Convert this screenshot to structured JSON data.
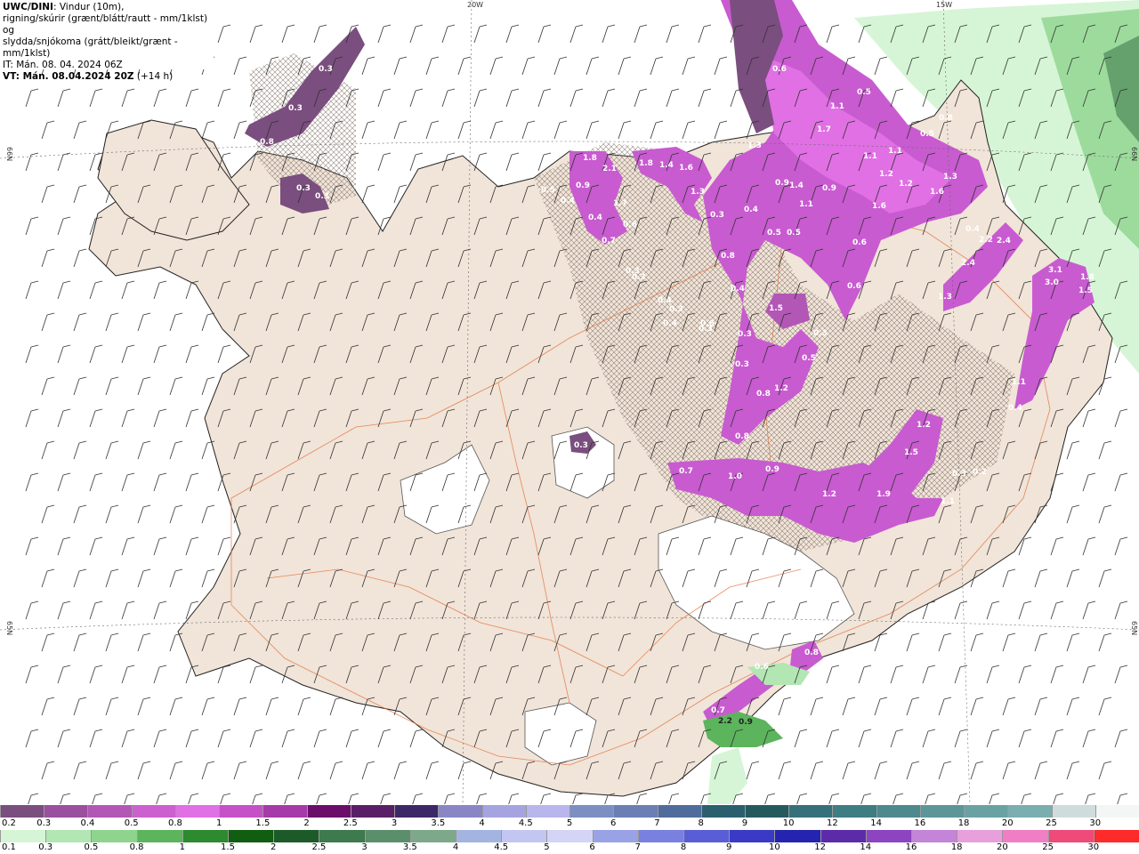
{
  "header": {
    "model": "UWC/DINI",
    "line1": ": Vindur (10m),",
    "line2": "rigning/skúrir (grænt/blátt/rautt - mm/1klst) og",
    "line3": "slydda/snjókoma (grátt/bleikt/grænt - mm/1klst)",
    "issue_time": "IT: Mán. 08. 04. 2024 06Z",
    "valid_time_label": "VT: Mán. 08.04.2024 20Z",
    "valid_offset": "(+14 h)"
  },
  "grid_labels": {
    "top_20w": "20W",
    "top_15w": "15W",
    "left_66n": "66N",
    "left_65n": "65N",
    "right_66n": "66N",
    "right_65n": "65N"
  },
  "precip_labels": [
    "0.3",
    "0.3",
    "0.8",
    "0.6",
    "0.5",
    "0.6",
    "0.8",
    "1.1",
    "1.7",
    "1.1",
    "1.1",
    "0.5",
    "0.9",
    "1.2",
    "1.2",
    "1.6",
    "1.3",
    "1.8",
    "1.4",
    "1.6",
    "1.3",
    "1.8",
    "0.5",
    "0.4",
    "0.9",
    "2.1",
    "0.4",
    "1.7",
    "0.6",
    "0.7",
    "0.3",
    "0.3",
    "1.3",
    "1.4",
    "1.1",
    "0.9",
    "1.6",
    "0.4",
    "0.5",
    "0.8",
    "0.6",
    "0.5",
    "0.4",
    "0.3",
    "1.5",
    "0.3",
    "0.3",
    "0.5",
    "0.3",
    "0.8",
    "1.2",
    "0.8",
    "0.3",
    "0.7",
    "1.0",
    "0.9",
    "1.2",
    "1.9",
    "1.1",
    "1.5",
    "1.2",
    "0.3",
    "0.2",
    "2.2",
    "2.4",
    "2.4",
    "1.3",
    "3.1",
    "3.0",
    "1.8",
    "1.5",
    "1.1",
    "0.4",
    "0.3",
    "0.4",
    "0.6",
    "0.8",
    "0.6",
    "2.2",
    "0.9",
    "0.7",
    "0.3",
    "0.3",
    "0.4",
    "0.3",
    "0.4"
  ],
  "snow_scale": {
    "values": [
      "0.2",
      "0.3",
      "0.4",
      "0.5",
      "0.8",
      "1",
      "1.5",
      "2",
      "2.5",
      "3",
      "3.5",
      "4",
      "4.5",
      "5",
      "6",
      "7",
      "8",
      "9",
      "10",
      "12",
      "14",
      "16",
      "18",
      "20",
      "25",
      "30"
    ],
    "colors": [
      "#7a4e7e",
      "#9a4f9f",
      "#b257b6",
      "#cc60cf",
      "#e070e4",
      "#c650c8",
      "#a53aa8",
      "#6a0e6a",
      "#5a1e66",
      "#3c2868",
      "#8a86c6",
      "#a6a4e0",
      "#b8b6ec",
      "#7d8fc2",
      "#6b7fb4",
      "#506c9c",
      "#2c5f6e",
      "#245a5e",
      "#36707a",
      "#3e7d82",
      "#4c8a8e",
      "#5c9698",
      "#6aa2a4",
      "#7aaeb0",
      "#cfdcdc",
      "#f4f6f6"
    ]
  },
  "rain_scale": {
    "values": [
      "0.1",
      "0.3",
      "0.5",
      "0.8",
      "1",
      "1.5",
      "2",
      "2.5",
      "3",
      "3.5",
      "4",
      "4.5",
      "5",
      "6",
      "7",
      "8",
      "9",
      "10",
      "12",
      "14",
      "16",
      "18",
      "20",
      "25",
      "30"
    ],
    "colors": [
      "#d6f5d6",
      "#b2e6b2",
      "#8ed48e",
      "#5cb45c",
      "#2e8a2e",
      "#115d11",
      "#1d5a2a",
      "#3d7a4d",
      "#5b8e6b",
      "#7da98a",
      "#a3b4e0",
      "#c3c6f0",
      "#d3d4f6",
      "#9aa2e6",
      "#7a80e0",
      "#5a5ed6",
      "#3a3ac6",
      "#2424b0",
      "#5c2ca8",
      "#8c44c0",
      "#c484d8",
      "#e8a0dc",
      "#f07ec4",
      "#ee4a7a",
      "#ff2a2a"
    ]
  }
}
